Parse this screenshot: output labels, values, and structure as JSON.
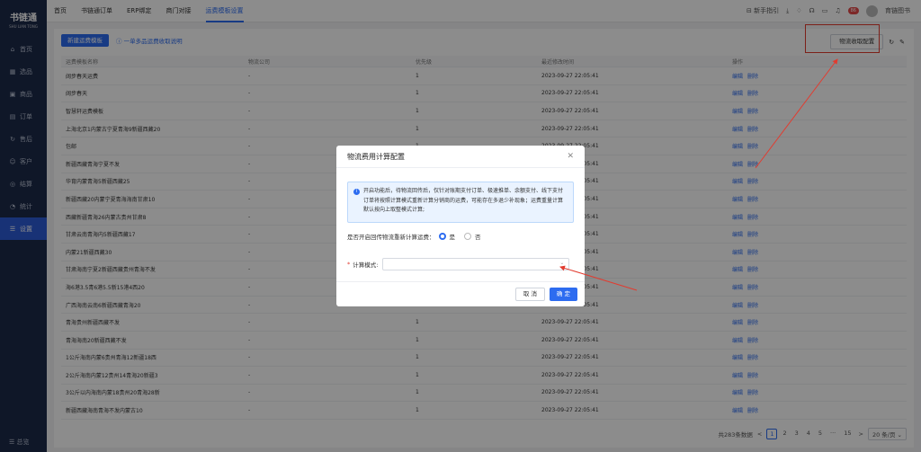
{
  "brand": {
    "title": "书链通",
    "subtitle": "SHU LIAN TONG"
  },
  "sidebar": {
    "items": [
      {
        "label": "首页",
        "icon": "home-icon",
        "glyph": "⌂"
      },
      {
        "label": "选品",
        "icon": "grid-icon",
        "glyph": "▦"
      },
      {
        "label": "商品",
        "icon": "box-icon",
        "glyph": "▣"
      },
      {
        "label": "订单",
        "icon": "order-icon",
        "glyph": "▤"
      },
      {
        "label": "售后",
        "icon": "service-icon",
        "glyph": "↻"
      },
      {
        "label": "客户",
        "icon": "user-icon",
        "glyph": "☺"
      },
      {
        "label": "结算",
        "icon": "settle-icon",
        "glyph": "◎"
      },
      {
        "label": "统计",
        "icon": "stats-icon",
        "glyph": "◔"
      },
      {
        "label": "设置",
        "icon": "settings-icon",
        "glyph": "☰"
      }
    ],
    "active_index": 8,
    "footer": "☰ 总览"
  },
  "topbar": {
    "tabs": [
      "首页",
      "书链通订单",
      "ERP绑定",
      "商门对接",
      "运费模板设置"
    ],
    "active_tab": 4,
    "guide": "⊟ 新手指引",
    "badge": "86",
    "user": "育链图书"
  },
  "page": {
    "new_button": "新建运费模板",
    "help_link": "ⓘ 一单多品运费收取说明",
    "config_button": "物流收取配置",
    "columns": [
      "运费模板名称",
      "物流公司",
      "优先级",
      "最近修改时间",
      "操作"
    ],
    "edit_label": "编辑",
    "delete_label": "删除",
    "rows": [
      [
        "阔步春天运费",
        "-",
        "1",
        "2023-09-27 22:05:41"
      ],
      [
        "阔步春天",
        "-",
        "1",
        "2023-09-27 22:05:41"
      ],
      [
        "智慧轩运费模板",
        "-",
        "1",
        "2023-09-27 22:05:41"
      ],
      [
        "上海北京1内蒙古宁夏青海9新疆西藏20",
        "-",
        "1",
        "2023-09-27 22:05:41"
      ],
      [
        "包邮",
        "-",
        "1",
        "2023-09-27 22:05:41"
      ],
      [
        "新疆西藏青海宁夏不发",
        "-",
        "1",
        "2023-09-27 22:05:41"
      ],
      [
        "华育内蒙青海5新疆西藏25",
        "-",
        "1",
        "2023-09-27 22:05:41"
      ],
      [
        "新疆西藏20内蒙宁夏青海海南甘肃10",
        "-",
        "1",
        "2023-09-27 22:05:41"
      ],
      [
        "西藏新疆青海26内蒙古贵州甘肃8",
        "-",
        "1",
        "2023-09-27 22:05:41"
      ],
      [
        "甘肃云南青海内5新疆西藏17",
        "-",
        "1",
        "2023-09-27 22:05:41"
      ],
      [
        "内蒙21新疆西藏30",
        "-",
        "1",
        "2023-09-27 22:05:41"
      ],
      [
        "甘肃海南宁夏2新疆西藏贵州青海不发",
        "-",
        "1",
        "2023-09-27 22:05:41"
      ],
      [
        "海6港3.5青6港5.5新15港4西20",
        "-",
        "1",
        "2023-09-27 22:05:41"
      ],
      [
        "广西海南云南6新疆西藏青海20",
        "-",
        "1",
        "2023-09-27 22:05:41"
      ],
      [
        "青海贵州新疆西藏不发",
        "-",
        "1",
        "2023-09-27 22:05:41"
      ],
      [
        "青海海南20新疆西藏不发",
        "-",
        "1",
        "2023-09-27 22:05:41"
      ],
      [
        "1公斤海南内蒙6贵州青海12新疆18西",
        "-",
        "1",
        "2023-09-27 22:05:41"
      ],
      [
        "2公斤海南内蒙12贵州14青海20新疆3",
        "-",
        "1",
        "2023-09-27 22:05:41"
      ],
      [
        "3公斤以内海南内蒙18贵州20青海28新",
        "-",
        "1",
        "2023-09-27 22:05:41"
      ],
      [
        "新疆西藏海南青海不发内蒙古10",
        "-",
        "1",
        "2023-09-27 22:05:41"
      ]
    ],
    "pager": {
      "total": "共283条数据",
      "pages": [
        "1",
        "2",
        "3",
        "4",
        "5",
        "···",
        "15"
      ],
      "current": "1",
      "prev": "<",
      "next": ">",
      "size": "20 条/页 ⌄"
    }
  },
  "modal": {
    "title": "物流费用计算配置",
    "close": "✕",
    "notice": "开启功能后，待物流回传后，仅针对账期支付订单、极速推单、余额支付、线下支付订单将按照计算模式重新计算分销商的运费，可能存在多退少补现象；运费重量计算默认按向上取整模式计算;",
    "question": "是否开启回传物流重新计算运费：",
    "yes": "是",
    "no": "否",
    "selected": "是",
    "field_label": "计算模式:",
    "field_required": "*",
    "field_value": "",
    "cancel": "取 消",
    "ok": "确 定"
  },
  "colors": {
    "primary": "#2d6cf0",
    "sidebar": "#1c2a4a",
    "highlight": "#e23b2f"
  }
}
